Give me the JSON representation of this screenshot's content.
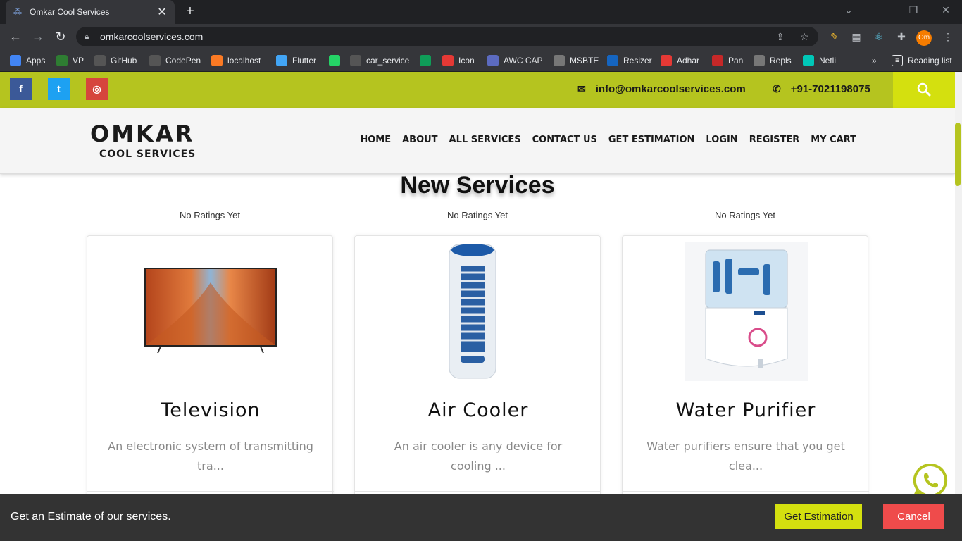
{
  "browser": {
    "tab_title": "Omkar Cool Services",
    "tab_close": "✕",
    "new_tab": "+",
    "url": "omkarcoolservices.com",
    "profile_initials": "Om",
    "bookmarks": [
      {
        "label": "Apps",
        "icon": "apps-grid-icon",
        "color": "#4285f4"
      },
      {
        "label": "VP",
        "icon": "vp-icon",
        "color": "#2e7d32"
      },
      {
        "label": "GitHub",
        "icon": "github-icon",
        "color": "#555555"
      },
      {
        "label": "CodePen",
        "icon": "codepen-icon",
        "color": "#555555"
      },
      {
        "label": "localhost",
        "icon": "xampp-icon",
        "color": "#fb7a24"
      },
      {
        "label": "Flutter",
        "icon": "flutter-icon",
        "color": "#42a5f5"
      },
      {
        "label": "",
        "icon": "whatsapp-icon",
        "color": "#25d366"
      },
      {
        "label": "car_service",
        "icon": "github-icon",
        "color": "#555555"
      },
      {
        "label": "",
        "icon": "sheets-icon",
        "color": "#0f9d58"
      },
      {
        "label": "Icon",
        "icon": "icon-grid-icon",
        "color": "#e53935"
      },
      {
        "label": "AWC CAP",
        "icon": "awc-icon",
        "color": "#5c6bc0"
      },
      {
        "label": "MSBTE",
        "icon": "msbte-icon",
        "color": "#777777"
      },
      {
        "label": "Resizer",
        "icon": "resizer-icon",
        "color": "#1565c0"
      },
      {
        "label": "Adhar",
        "icon": "adhar-icon",
        "color": "#e53935"
      },
      {
        "label": "Pan",
        "icon": "pan-icon",
        "color": "#c62828"
      },
      {
        "label": "Repls",
        "icon": "repl-icon",
        "color": "#777777"
      },
      {
        "label": "Netli",
        "icon": "netlify-icon",
        "color": "#00c7b7"
      }
    ],
    "more_bookmarks": "»",
    "reading_list": "Reading list"
  },
  "site": {
    "topbar": {
      "social": [
        {
          "name": "facebook",
          "glyph": "f",
          "color": "#3b5998"
        },
        {
          "name": "twitter",
          "glyph": "t",
          "color": "#1da1f2"
        },
        {
          "name": "instagram",
          "glyph": "◎",
          "color": "#d6453d"
        }
      ],
      "email": "info@omkarcoolservices.com",
      "phone": "+91-7021198075"
    },
    "logo": {
      "main": "OMKAR",
      "sub": "COOL SERVICES"
    },
    "nav": [
      "HOME",
      "ABOUT",
      "ALL SERVICES",
      "CONTACT US",
      "GET ESTIMATION",
      "LOGIN",
      "REGISTER",
      "MY CART"
    ],
    "section_title": "New Services",
    "services": [
      {
        "rating": "No Ratings Yet",
        "title": "Television",
        "desc": "An electronic system of transmitting tra..."
      },
      {
        "rating": "No Ratings Yet",
        "title": "Air Cooler",
        "desc": "An air cooler is any device for cooling ..."
      },
      {
        "rating": "No Ratings Yet",
        "title": "Water Purifier",
        "desc": "Water purifiers ensure that you get clea..."
      }
    ],
    "cookie_bar": {
      "text": "Get an Estimate of our services.",
      "estimate_label": "Get Estimation",
      "cancel_label": "Cancel"
    },
    "colors": {
      "accent": "#b5c41f",
      "accent_bright": "#d4e00f",
      "cancel": "#ef4b4b",
      "whatsapp": "#b5c41f"
    }
  }
}
